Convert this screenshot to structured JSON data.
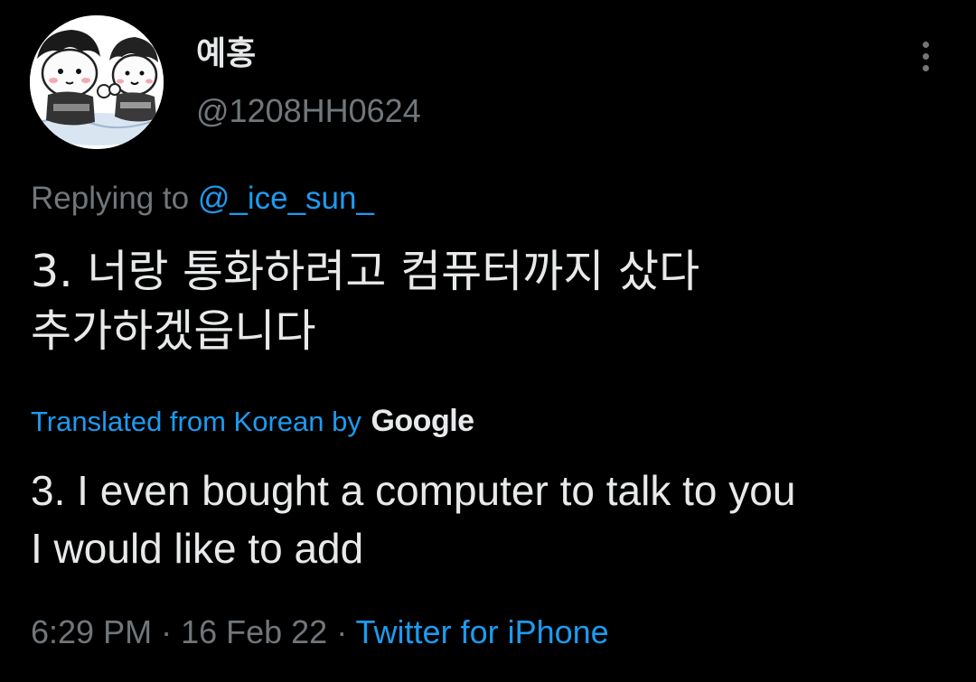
{
  "user": {
    "display_name": "예홍",
    "handle": "@1208HH0624",
    "avatar_icon": "illustrated-avatar-icon"
  },
  "more_icon": "more-vertical-icon",
  "reply_context": {
    "prefix": "Replying to ",
    "mention": "@_ice_sun_"
  },
  "tweet": {
    "text": "3. 너랑 통화하려고 컴퓨터까지 샀다\n추가하겠읍니다"
  },
  "translation": {
    "label": "Translated from Korean by ",
    "provider": "Google",
    "text": "3. I even bought a computer to talk to you\n I would like to add"
  },
  "meta": {
    "time": "6:29 PM",
    "date": "16 Feb 22",
    "separator": " · ",
    "source": "Twitter for iPhone"
  },
  "colors": {
    "background": "#000000",
    "primary_text": "#e7e9ea",
    "secondary_text": "#71767b",
    "link": "#1d9bf0"
  }
}
